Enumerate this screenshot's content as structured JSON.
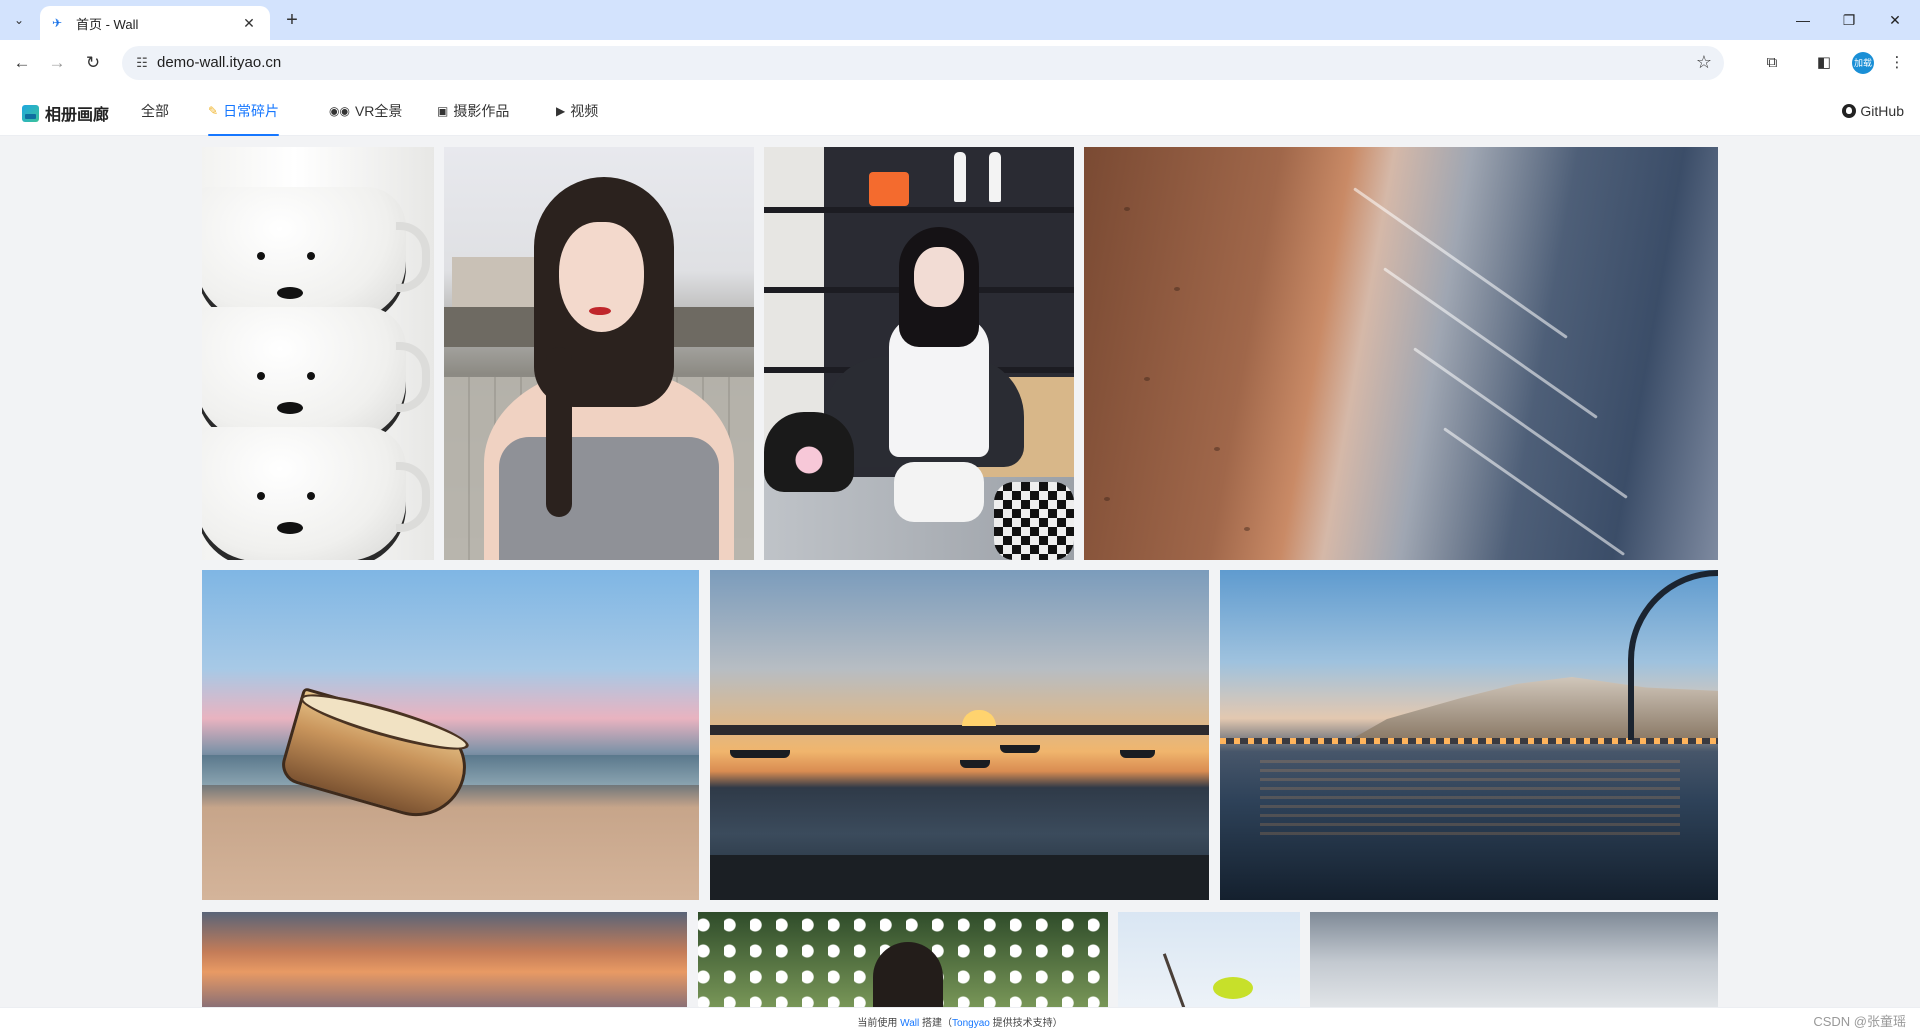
{
  "browser": {
    "tab_title": "首页 - Wall",
    "url": "demo-wall.ityao.cn",
    "profile_label": "加载"
  },
  "site": {
    "logo_text": "相册画廊",
    "nav": [
      {
        "label": "全部",
        "icon": ""
      },
      {
        "label": "日常碎片",
        "icon": "pencil-icon"
      },
      {
        "label": "VR全景",
        "icon": "vr-goggles-icon"
      },
      {
        "label": "摄影作品",
        "icon": "camera-icon"
      },
      {
        "label": "视频",
        "icon": "video-icon"
      }
    ],
    "active_nav": "日常碎片",
    "github_label": "GitHub",
    "accent_color": "#1677ff"
  },
  "footer": {
    "prefix": "当前使用",
    "wall": "Wall",
    "middle": "搭建（",
    "tongyao": "Tongyao",
    "suffix": "提供技术支持）",
    "watermark": "CSDN @张童瑶"
  }
}
